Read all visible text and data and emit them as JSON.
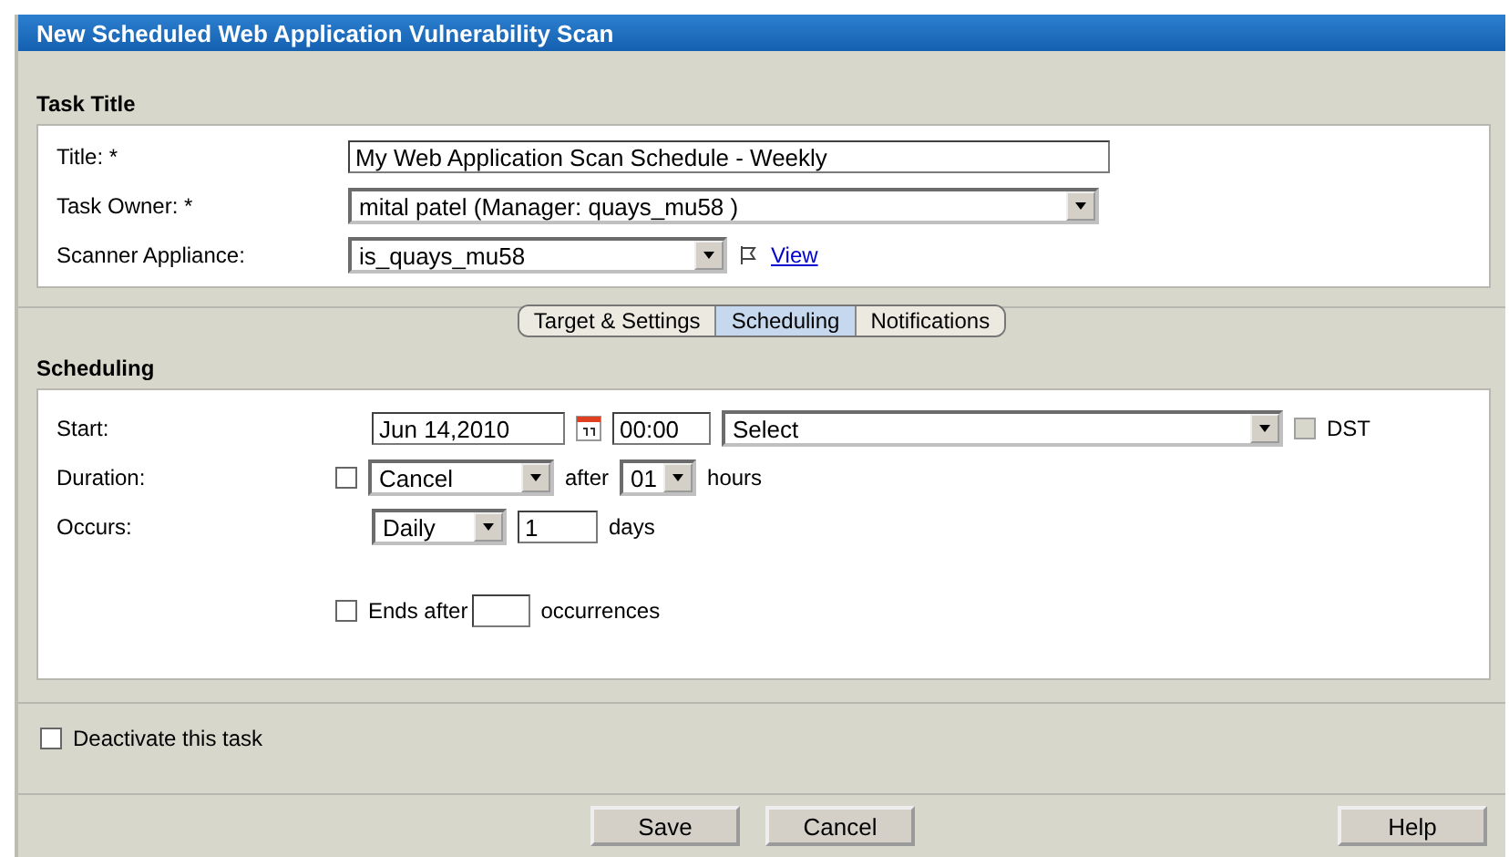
{
  "window": {
    "title": "New Scheduled Web Application Vulnerability Scan"
  },
  "task_title": {
    "heading": "Task Title",
    "fields": [
      {
        "label": "Title: *",
        "kind": "text",
        "value": "My Web Application Scan Schedule - Weekly"
      },
      {
        "label": "Task Owner: *",
        "kind": "select",
        "value": "mital patel (Manager: quays_mu58 )"
      },
      {
        "label": "Scanner Appliance:",
        "kind": "select",
        "value": "is_quays_mu58",
        "link": "View"
      }
    ]
  },
  "tabs": [
    {
      "label": "Target & Settings",
      "selected": false
    },
    {
      "label": "Scheduling",
      "selected": true
    },
    {
      "label": "Notifications",
      "selected": false
    }
  ],
  "scheduling": {
    "heading": "Scheduling",
    "start": {
      "label": "Start:",
      "date": "Jun 14,2010",
      "time": "00:00",
      "timezone": "Select",
      "dst": {
        "label": "DST",
        "checked": false,
        "disabled": true
      }
    },
    "duration": {
      "label": "Duration:",
      "checked": false,
      "action": "Cancel",
      "after": "after",
      "hours": "01",
      "unit": "hours"
    },
    "occurs": {
      "label": "Occurs:",
      "frequency": "Daily",
      "interval": "1",
      "unit": "days"
    },
    "ends": {
      "checked": false,
      "label": "Ends after",
      "unit": "occurrences"
    }
  },
  "deactivate": {
    "label": "Deactivate this task",
    "checked": false
  },
  "buttons": [
    {
      "label": "Save"
    },
    {
      "label": "Cancel"
    }
  ],
  "help": {
    "label": "Help"
  }
}
